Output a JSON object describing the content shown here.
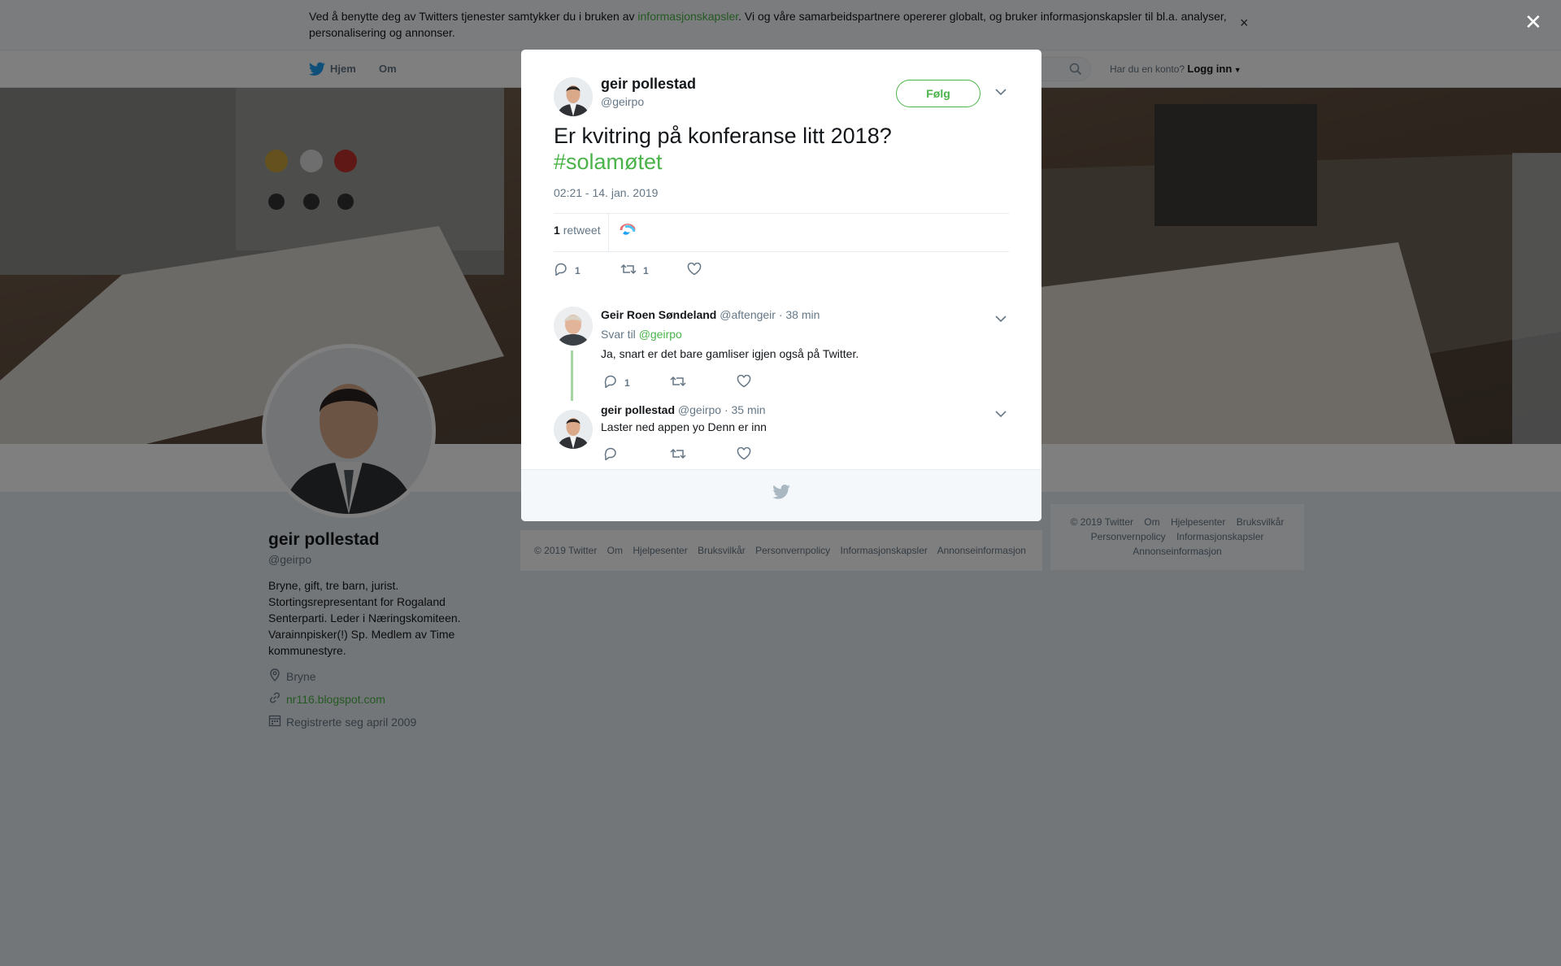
{
  "cookie_bar": {
    "text_before": "Ved å benytte deg av Twitters tjenester samtykker du i bruken av ",
    "link": "informasjonskapsler",
    "text_after": ". Vi og våre samarbeidspartnere opererer globalt, og bruker informasjonskapsler til bl.a. analyser, personalisering og annonser.",
    "close": "×"
  },
  "nav": {
    "home": "Hjem",
    "about": "Om",
    "have_account": "Har du en konto?",
    "login": "Logg inn"
  },
  "profile": {
    "name": "geir pollestad",
    "handle": "@geirpo",
    "bio": "Bryne, gift, tre barn, jurist. Stortingsrepresentant for Rogaland Senterparti. Leder i Næringskomiteen. Varainnpisker(!) Sp. Medlem av Time kommunestyre.",
    "location": "Bryne",
    "website": "nr116.blogspot.com",
    "joined": "Registrerte seg april 2009"
  },
  "footer": [
    "© 2019 Twitter",
    "Om",
    "Hjelpesenter",
    "Bruksvilkår",
    "Personvernpolicy",
    "Informasjonskapsler",
    "Annonseinformasjon"
  ],
  "side_footer": {
    "line1": [
      "© 2019 Twitter",
      "Om",
      "Hjelpesenter",
      "Bruksvilkår"
    ],
    "line2": [
      "Personvernpolicy",
      "Informasjonskapsler"
    ],
    "line3": [
      "Annonseinformasjon"
    ]
  },
  "overlay_close": "✕",
  "tweet": {
    "name": "geir pollestad",
    "handle": "@geirpo",
    "follow": "Følg",
    "text": "Er kvitring på konferanse litt 2018?",
    "hashtag": "#solamøtet",
    "time": "02:21 - 14. jan. 2019",
    "retweet_count": "1",
    "retweet_label": "retweet",
    "reply_count": "1",
    "rt_count": "1"
  },
  "replies": [
    {
      "name": "Geir Roen Søndeland",
      "handle": "@aftengeir",
      "time": "· 38 min",
      "reply_to_label": "Svar til",
      "reply_to": "@geirpo",
      "text": "Ja, snart er det bare gamliser igjen også på Twitter.",
      "reply_count": "1"
    },
    {
      "name": "geir pollestad",
      "handle": "@geirpo",
      "time": "· 35 min",
      "text": "Laster ned appen yo Denn er inn"
    }
  ],
  "colors": {
    "accent": "#4ab349",
    "overlay": "rgba(0,0,0,0.5)"
  }
}
